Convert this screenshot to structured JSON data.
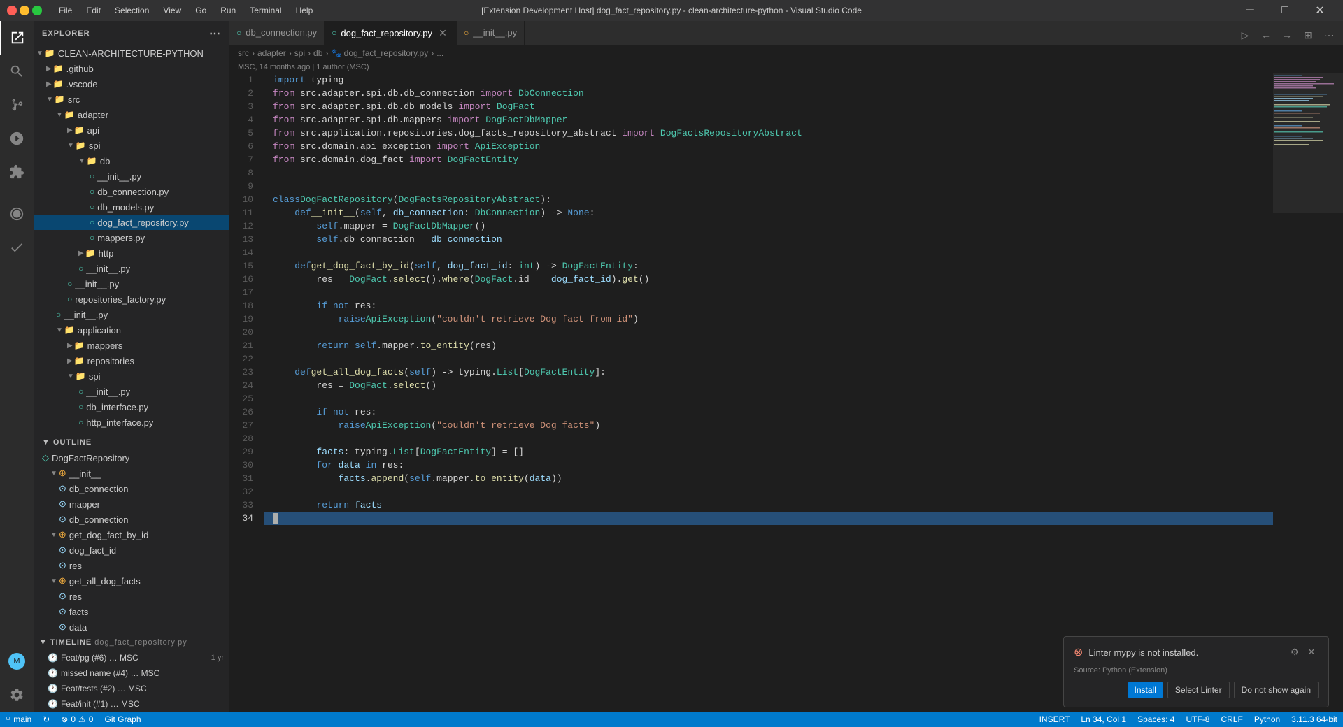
{
  "titlebar": {
    "title": "[Extension Development Host] dog_fact_repository.py - clean-architecture-python - Visual Studio Code",
    "menu": [
      "File",
      "Edit",
      "Selection",
      "View",
      "Go",
      "Run",
      "Terminal",
      "Help"
    ],
    "controls": [
      "─",
      "□",
      "✕"
    ]
  },
  "activity_bar": {
    "icons": [
      {
        "name": "explorer-icon",
        "symbol": "⎘",
        "active": true
      },
      {
        "name": "search-icon",
        "symbol": "🔍"
      },
      {
        "name": "source-control-icon",
        "symbol": "⑂"
      },
      {
        "name": "run-icon",
        "symbol": "▷"
      },
      {
        "name": "extensions-icon",
        "symbol": "⊞"
      },
      {
        "name": "remote-icon",
        "symbol": "⊕"
      },
      {
        "name": "test-icon",
        "symbol": "⚗"
      },
      {
        "name": "settings-icon",
        "symbol": "⚙"
      }
    ]
  },
  "sidebar": {
    "title": "EXPLORER",
    "project": "CLEAN-ARCHITECTURE-PYTHON",
    "tree": [
      {
        "level": 0,
        "type": "folder",
        "label": ".github",
        "expanded": false
      },
      {
        "level": 0,
        "type": "folder",
        "label": ".vscode",
        "expanded": false
      },
      {
        "level": 0,
        "type": "folder",
        "label": "src",
        "expanded": true
      },
      {
        "level": 1,
        "type": "folder",
        "label": "adapter",
        "expanded": true
      },
      {
        "level": 2,
        "type": "folder",
        "label": "api",
        "expanded": false
      },
      {
        "level": 2,
        "type": "folder",
        "label": "spi",
        "expanded": true
      },
      {
        "level": 3,
        "type": "folder",
        "label": "db",
        "expanded": true
      },
      {
        "level": 4,
        "type": "file",
        "label": "__init__.py",
        "fileType": "py"
      },
      {
        "level": 4,
        "type": "file",
        "label": "db_connection.py",
        "fileType": "py"
      },
      {
        "level": 4,
        "type": "file",
        "label": "db_models.py",
        "fileType": "py"
      },
      {
        "level": 4,
        "type": "file",
        "label": "dog_fact_repository.py",
        "fileType": "py",
        "selected": true
      },
      {
        "level": 4,
        "type": "file",
        "label": "mappers.py",
        "fileType": "py"
      },
      {
        "level": 3,
        "type": "folder",
        "label": "http",
        "expanded": false
      },
      {
        "level": 2,
        "type": "file",
        "label": "__init__.py",
        "fileType": "py"
      },
      {
        "level": 1,
        "type": "file",
        "label": "__init__.py",
        "fileType": "py"
      },
      {
        "level": 1,
        "type": "file",
        "label": "repositories_factory.py",
        "fileType": "py"
      },
      {
        "level": 0,
        "type": "file",
        "label": "__init__.py",
        "fileType": "py"
      },
      {
        "level": 0,
        "type": "folder",
        "label": "application",
        "expanded": true
      },
      {
        "level": 1,
        "type": "folder",
        "label": "mappers",
        "expanded": false
      },
      {
        "level": 1,
        "type": "folder",
        "label": "repositories",
        "expanded": false
      },
      {
        "level": 1,
        "type": "folder",
        "label": "spi",
        "expanded": true
      },
      {
        "level": 2,
        "type": "file",
        "label": "__init__.py",
        "fileType": "py"
      },
      {
        "level": 2,
        "type": "file",
        "label": "db_interface.py",
        "fileType": "py"
      },
      {
        "level": 2,
        "type": "file",
        "label": "http_interface.py",
        "fileType": "py"
      }
    ]
  },
  "outline": {
    "title": "OUTLINE",
    "items": [
      {
        "level": 0,
        "type": "class",
        "label": "DogFactRepository"
      },
      {
        "level": 1,
        "type": "method",
        "label": "__init__"
      },
      {
        "level": 2,
        "type": "var",
        "label": "db_connection"
      },
      {
        "level": 2,
        "type": "var",
        "label": "mapper"
      },
      {
        "level": 2,
        "type": "var",
        "label": "db_connection"
      },
      {
        "level": 1,
        "type": "method",
        "label": "get_dog_fact_by_id"
      },
      {
        "level": 2,
        "type": "var",
        "label": "dog_fact_id"
      },
      {
        "level": 2,
        "type": "var",
        "label": "res"
      },
      {
        "level": 1,
        "type": "method",
        "label": "get_all_dog_facts"
      },
      {
        "level": 2,
        "type": "var",
        "label": "res"
      },
      {
        "level": 2,
        "type": "var",
        "label": "facts"
      },
      {
        "level": 2,
        "type": "var",
        "label": "data"
      }
    ]
  },
  "timeline": {
    "title": "TIMELINE",
    "file": "dog_fact_repository.py",
    "items": [
      {
        "label": "Feat/pg (#6) …",
        "author": "MSC",
        "time": "1 yr"
      },
      {
        "label": "missed name (#4) …",
        "author": "MSC",
        "time": ""
      },
      {
        "label": "Feat/tests (#2) …",
        "author": "MSC",
        "time": ""
      },
      {
        "label": "Feat/init (#1) …",
        "author": "MSC",
        "time": ""
      }
    ]
  },
  "tabs": [
    {
      "label": "db_connection.py",
      "active": false,
      "modified": false
    },
    {
      "label": "dog_fact_repository.py",
      "active": true,
      "modified": false
    },
    {
      "label": "__init__.py",
      "active": false,
      "modified": false
    }
  ],
  "breadcrumb": [
    "src",
    ">",
    "adapter",
    ">",
    "spi",
    ">",
    "db",
    ">",
    "🐾 dog_fact_repository.py",
    ">",
    "..."
  ],
  "blame": "MSC, 14 months ago | 1 author (MSC)",
  "blame2": "MSC, 14 months ago | 1 author (MSC)",
  "code": {
    "lines": [
      {
        "num": 1,
        "content": "import typing"
      },
      {
        "num": 2,
        "content": "from src.adapter.spi.db.db_connection import DbConnection"
      },
      {
        "num": 3,
        "content": "from src.adapter.spi.db.db_models import DogFact"
      },
      {
        "num": 4,
        "content": "from src.adapter.spi.db.mappers import DogFactDbMapper"
      },
      {
        "num": 5,
        "content": "from src.application.repositories.dog_facts_repository_abstract import DogFactsRepositoryAbstract"
      },
      {
        "num": 6,
        "content": "from src.domain.api_exception import ApiException"
      },
      {
        "num": 7,
        "content": "from src.domain.dog_fact import DogFactEntity"
      },
      {
        "num": 8,
        "content": ""
      },
      {
        "num": 9,
        "content": ""
      },
      {
        "num": 10,
        "content": "class DogFactRepository(DogFactsRepositoryAbstract):"
      },
      {
        "num": 11,
        "content": "    def __init__(self, db_connection: DbConnection) -> None:"
      },
      {
        "num": 12,
        "content": "        self.mapper = DogFactDbMapper()"
      },
      {
        "num": 13,
        "content": "        self.db_connection = db_connection"
      },
      {
        "num": 14,
        "content": ""
      },
      {
        "num": 15,
        "content": "    def get_dog_fact_by_id(self, dog_fact_id: int) -> DogFactEntity:"
      },
      {
        "num": 16,
        "content": "        res = DogFact.select().where(DogFact.id == dog_fact_id).get()"
      },
      {
        "num": 17,
        "content": ""
      },
      {
        "num": 18,
        "content": "        if not res:"
      },
      {
        "num": 19,
        "content": "            raise ApiException(\"couldn't retrieve Dog fact from id\")"
      },
      {
        "num": 20,
        "content": ""
      },
      {
        "num": 21,
        "content": "        return self.mapper.to_entity(res)"
      },
      {
        "num": 22,
        "content": ""
      },
      {
        "num": 23,
        "content": "    def get_all_dog_facts(self) -> typing.List[DogFactEntity]:"
      },
      {
        "num": 24,
        "content": "        res = DogFact.select()"
      },
      {
        "num": 25,
        "content": ""
      },
      {
        "num": 26,
        "content": "        if not res:"
      },
      {
        "num": 27,
        "content": "            raise ApiException(\"couldn't retrieve Dog facts\")"
      },
      {
        "num": 28,
        "content": ""
      },
      {
        "num": 29,
        "content": "        facts: typing.List[DogFactEntity] = []"
      },
      {
        "num": 30,
        "content": "        for data in res:"
      },
      {
        "num": 31,
        "content": "            facts.append(self.mapper.to_entity(data))"
      },
      {
        "num": 32,
        "content": ""
      },
      {
        "num": 33,
        "content": "        return facts"
      },
      {
        "num": 34,
        "content": ""
      }
    ]
  },
  "notification": {
    "message": "Linter mypy is not installed.",
    "source": "Source: Python (Extension)",
    "buttons": {
      "install": "Install",
      "select_linter": "Select Linter",
      "do_not_show": "Do not show again"
    }
  },
  "statusbar": {
    "left": [
      {
        "icon": "⑂",
        "label": "main"
      },
      {
        "icon": "↻",
        "label": ""
      },
      {
        "icon": "⊗",
        "label": "0"
      },
      {
        "icon": "⚠",
        "label": "0"
      },
      {
        "label": "Git Graph"
      }
    ],
    "right": [
      {
        "label": "Ln 34, Col 1"
      },
      {
        "label": "Spaces: 4"
      },
      {
        "label": "UTF-8"
      },
      {
        "label": "CRLF"
      },
      {
        "label": "Python"
      },
      {
        "label": "3.11.3 64-bit"
      },
      {
        "label": "INSERT"
      }
    ]
  }
}
